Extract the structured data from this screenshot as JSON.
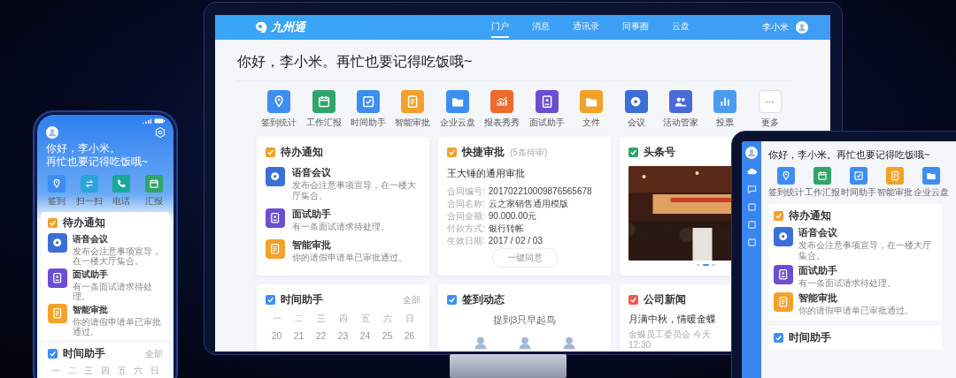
{
  "monitor": {
    "logo": "九州通",
    "user": "李小米",
    "nav": [
      {
        "label": "门户",
        "selected": true
      },
      {
        "label": "消息",
        "selected": false
      },
      {
        "label": "通讯录",
        "selected": false
      },
      {
        "label": "同事圈",
        "selected": false
      },
      {
        "label": "云盘",
        "selected": false
      }
    ],
    "greeting": "你好，李小米。再忙也要记得吃饭哦~",
    "apps": [
      {
        "label": "签到统计",
        "color": "#3d8ef0",
        "kind": "app"
      },
      {
        "label": "工作汇报",
        "color": "#2fa56a",
        "kind": "app"
      },
      {
        "label": "时间助手",
        "color": "#3d8ef0",
        "kind": "app"
      },
      {
        "label": "智能审批",
        "color": "#f3a12a",
        "kind": "app"
      },
      {
        "label": "企业云盘",
        "color": "#3d8ef0",
        "kind": "app"
      },
      {
        "label": "报表秀秀",
        "color": "#ef6a2e",
        "kind": "app"
      },
      {
        "label": "面试助手",
        "color": "#6c4fd0",
        "kind": "app"
      },
      {
        "label": "文件",
        "color": "#f3a12a",
        "kind": "app"
      },
      {
        "label": "会议",
        "color": "#3c6fd6",
        "kind": "app"
      },
      {
        "label": "活动管家",
        "color": "#4a6ad8",
        "kind": "app"
      },
      {
        "label": "投票",
        "color": "#4a9cf0",
        "kind": "app"
      },
      {
        "label": "更多",
        "color": "#ffffff",
        "kind": "more"
      }
    ],
    "todo": {
      "title": "待办通知",
      "color": "#f3a12a",
      "items": [
        {
          "title": "语音会议",
          "desc": "发布会注意事项宣导，在一楼大厅集合。",
          "color": "#3c6fd6"
        },
        {
          "title": "面试助手",
          "desc": "有一条面试请求待处理。",
          "color": "#6c4fd0"
        },
        {
          "title": "智能审批",
          "desc": "你的请假申请单已审批通过。",
          "color": "#f3a12a"
        }
      ]
    },
    "approval": {
      "title": "快捷审批",
      "color": "#f3a12a",
      "note": "(5条待审)",
      "subject": "王大锤的通用审批",
      "fields": [
        {
          "label": "合同编号:",
          "value": "201702210009876565678"
        },
        {
          "label": "合同名称:",
          "value": "云之家销售通用模版"
        },
        {
          "label": "合同金额:",
          "value": "90.000.00元"
        },
        {
          "label": "付款方式:",
          "value": "银行转帐"
        },
        {
          "label": "生效日期:",
          "value": "2017 / 02 / 03"
        }
      ],
      "button": "一键同意"
    },
    "headline": {
      "title": "头条号",
      "color": "#2fa56a",
      "pager": [
        {
          "selected": false
        },
        {
          "selected": true
        },
        {
          "selected": false
        }
      ]
    },
    "calendar": {
      "title": "时间助手",
      "color": "#3d8ef0",
      "link": "全部",
      "weekdays": [
        "一",
        "二",
        "三",
        "四",
        "五",
        "六",
        "日"
      ],
      "dates": [
        "20",
        "21",
        "22",
        "23",
        "24",
        "25",
        "26"
      ]
    },
    "checkin": {
      "title": "签到动态",
      "color": "#3d8ef0",
      "caption": "捉到3只早起鸟"
    },
    "news": {
      "title": "公司新闻",
      "color": "#ef5a4a",
      "headline": "月满中秋，情暖金蝶",
      "meta": "金蝶员工委员会 今天 12:30"
    }
  },
  "phone": {
    "greeting": [
      "你好，李小米。",
      "再忙也要记得吃饭哦~"
    ],
    "apps": [
      {
        "label": "签到",
        "color": "#3d8ef0"
      },
      {
        "label": "扫一扫",
        "color": "#2ba4d8"
      },
      {
        "label": "电话",
        "color": "#19a99a"
      },
      {
        "label": "汇报",
        "color": "#2fa56a"
      }
    ],
    "todo": {
      "title": "待办通知",
      "color": "#f3a12a",
      "items": [
        {
          "title": "语音会议",
          "desc": "发布会注意事项宣导，在一楼大厅集合。",
          "color": "#3c6fd6"
        },
        {
          "title": "面试助手",
          "desc": "有一条面试请求待处理。",
          "color": "#6c4fd0"
        },
        {
          "title": "智能审批",
          "desc": "你的请假申请单已审批通过。",
          "color": "#f3a12a"
        }
      ]
    },
    "calendar": {
      "title": "时间助手",
      "color": "#3d8ef0",
      "link": "全部",
      "weekdays": [
        "一",
        "二",
        "三",
        "四",
        "五",
        "六",
        "日"
      ]
    }
  },
  "tablet": {
    "greeting": "你好，李小米。再忙也要记得吃饭哦~",
    "apps": [
      {
        "label": "签到统计",
        "color": "#3d8ef0"
      },
      {
        "label": "工作汇报",
        "color": "#2fa56a"
      },
      {
        "label": "时间助手",
        "color": "#3d8ef0"
      },
      {
        "label": "智能审批",
        "color": "#f3a12a"
      },
      {
        "label": "企业云盘",
        "color": "#3d8ef0"
      }
    ],
    "todo": {
      "title": "待办通知",
      "color": "#f3a12a",
      "items": [
        {
          "title": "语音会议",
          "desc": "发布会注意事项宣导，在一楼大厅集合。",
          "color": "#3c6fd6"
        },
        {
          "title": "面试助手",
          "desc": "有一条面试请求待处理。",
          "color": "#6c4fd0"
        },
        {
          "title": "智能审批",
          "desc": "你的请假申请单已审批通过。",
          "color": "#f3a12a"
        }
      ]
    },
    "calendar": {
      "title": "时间助手",
      "color": "#3d8ef0"
    }
  }
}
